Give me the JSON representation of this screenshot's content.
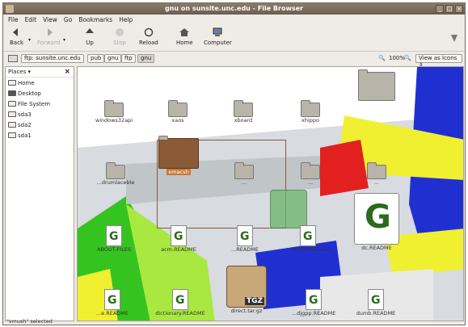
{
  "window": {
    "title": "gnu on sunsite.unc.edu - File Browser"
  },
  "menu": [
    "File",
    "Edit",
    "View",
    "Go",
    "Bookmarks",
    "Help"
  ],
  "toolbar": {
    "back": "Back",
    "forward": "Forward",
    "up": "Up",
    "stop": "Stop",
    "reload": "Reload",
    "home": "Home",
    "computer": "Computer"
  },
  "location": {
    "root": "ftp: sunsite.unc.edu",
    "crumbs": [
      "pub",
      "gnu",
      "ftp",
      "gnu"
    ],
    "zoom": "100%",
    "view_mode": "View as Icons"
  },
  "sidebar": {
    "title": "Places",
    "items": [
      "Home",
      "Desktop",
      "File System",
      "sda3",
      "sda2",
      "sda1"
    ]
  },
  "files": {
    "row1": [
      "windows32api",
      "xaos",
      "xboard",
      "xhippo"
    ],
    "row2": [
      "...drumlaceble",
      "emacsh",
      "...",
      "...",
      "..."
    ],
    "row3": [
      "ABOUT-FILES",
      "acm.README",
      "...README",
      "...TORS.FAR.shar",
      "dc.README"
    ],
    "row4": [
      "...e.README",
      "dictionary.README",
      "direct.tar.gz",
      "...djgpp.README",
      "dumb.README"
    ]
  },
  "colors": {
    "titlebar": "#6b5e50",
    "accent_folder": "#8b5a36",
    "green": "#35c41f",
    "yellow": "#f0f030",
    "red": "#e32020",
    "blue": "#2030d0"
  },
  "status": "\"smush\" selected"
}
